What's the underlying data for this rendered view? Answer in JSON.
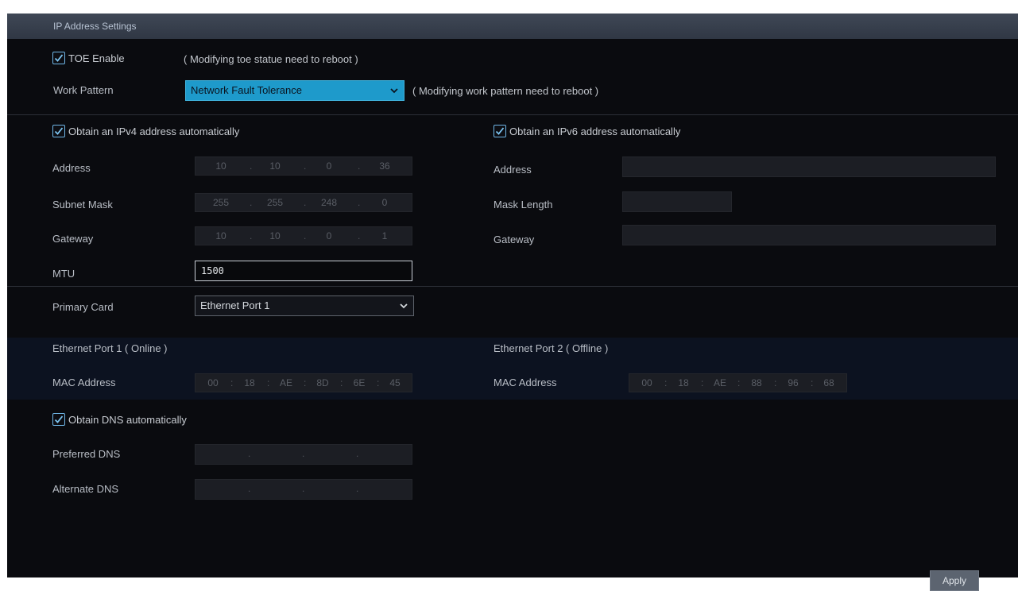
{
  "header": {
    "title": "IP Address Settings"
  },
  "toe": {
    "label": "TOE Enable",
    "checked": true,
    "note": "( Modifying toe statue need to reboot )"
  },
  "work_pattern": {
    "label": "Work Pattern",
    "value": "Network Fault Tolerance",
    "note": "( Modifying work pattern need to reboot )"
  },
  "ipv4": {
    "auto_label": "Obtain an IPv4 address automatically",
    "address_label": "Address",
    "address": [
      "10",
      "10",
      "0",
      "36"
    ],
    "subnet_label": "Subnet Mask",
    "subnet": [
      "255",
      "255",
      "248",
      "0"
    ],
    "gateway_label": "Gateway",
    "gateway": [
      "10",
      "10",
      "0",
      "1"
    ],
    "mtu_label": "MTU",
    "mtu": "1500"
  },
  "ipv6": {
    "auto_label": "Obtain an IPv6 address automatically",
    "address_label": "Address",
    "mask_label": "Mask Length",
    "gateway_label": "Gateway"
  },
  "primary_card": {
    "label": "Primary Card",
    "value": "Ethernet Port 1"
  },
  "port1": {
    "title": "Ethernet Port 1 ( Online )",
    "mac_label": "MAC Address",
    "mac": [
      "00",
      "18",
      "AE",
      "8D",
      "6E",
      "45"
    ]
  },
  "port2": {
    "title": "Ethernet Port 2 ( Offline )",
    "mac_label": "MAC Address",
    "mac": [
      "00",
      "18",
      "AE",
      "88",
      "96",
      "68"
    ]
  },
  "dns": {
    "auto_label": "Obtain DNS automatically",
    "preferred_label": "Preferred DNS",
    "alternate_label": "Alternate DNS"
  },
  "apply_label": "Apply",
  "colors": {
    "accent": "#2096c8",
    "checkbox": "#6fb6e6",
    "panel_bg": "#0a0b0f",
    "header_bg": "#3a4250"
  }
}
